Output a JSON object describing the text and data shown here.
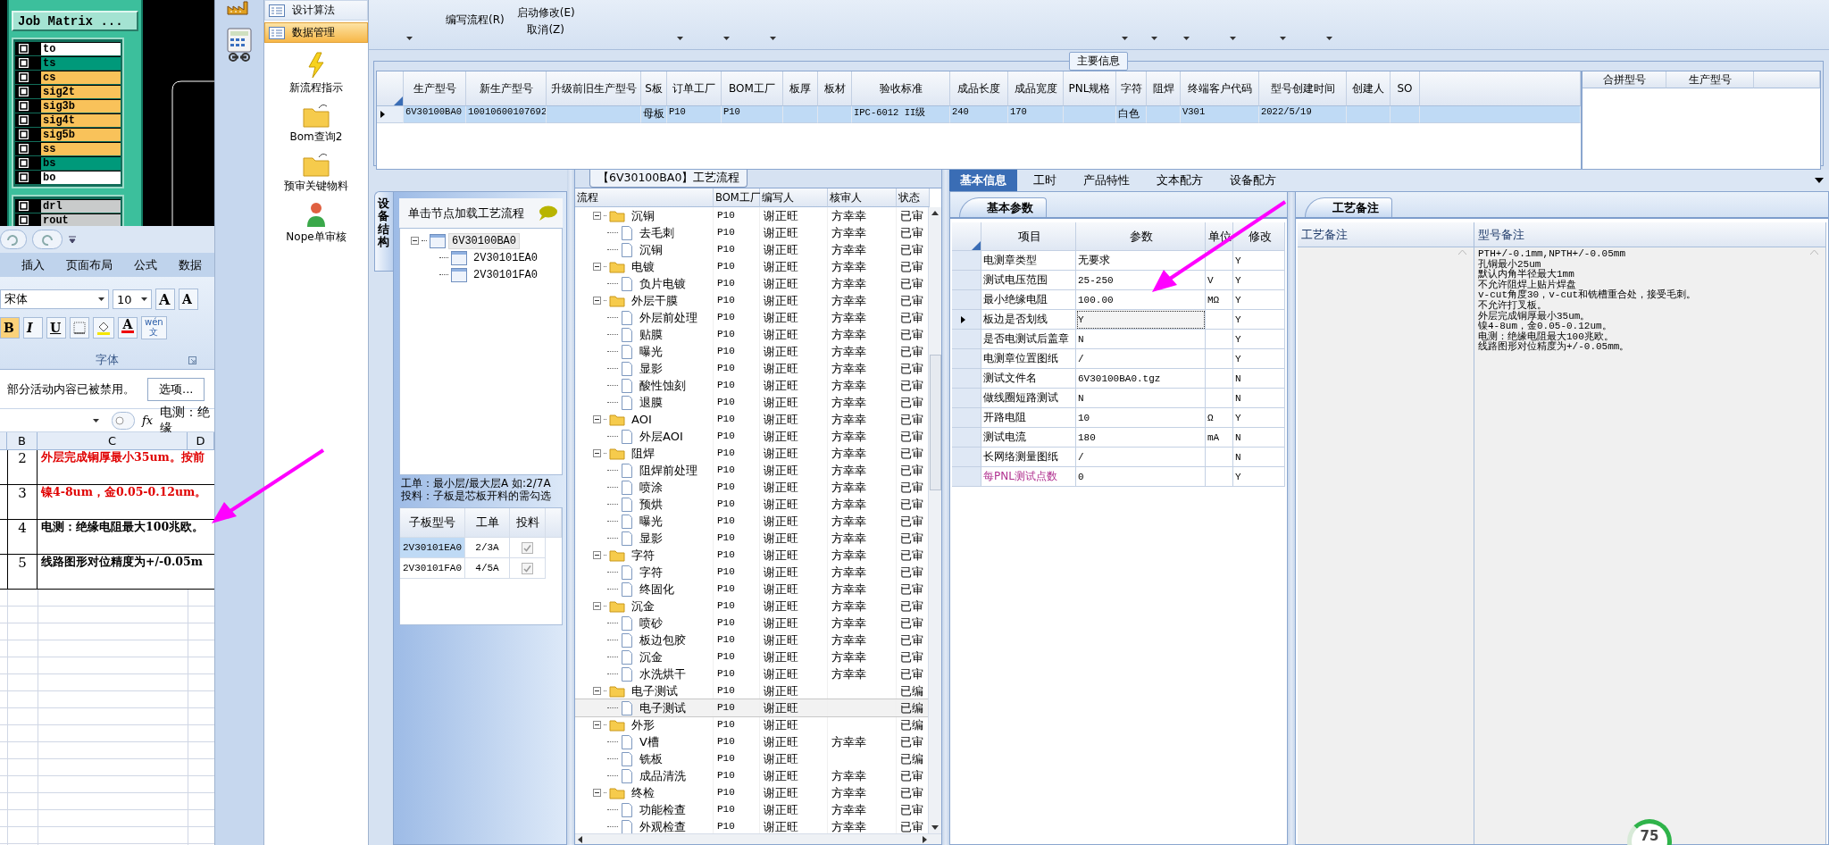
{
  "cad_window": {
    "button": "Job Matrix ...",
    "layer_groups": [
      {
        "layers": [
          {
            "name": "to",
            "color": "#ffffff",
            "checked": false
          },
          {
            "name": "ts",
            "color": "#00997a",
            "checked": false
          },
          {
            "name": "cs",
            "color": "#f9c25a",
            "checked": false
          },
          {
            "name": "sig2t",
            "color": "#f9c25a",
            "checked": false
          },
          {
            "name": "sig3b",
            "color": "#f9c25a",
            "checked": false
          },
          {
            "name": "sig4t",
            "color": "#f9c25a",
            "checked": false
          },
          {
            "name": "sig5b",
            "color": "#f9c25a",
            "checked": false
          },
          {
            "name": "ss",
            "color": "#f9c25a",
            "checked": false
          },
          {
            "name": "bs",
            "color": "#00997a",
            "checked": false
          },
          {
            "name": "bo",
            "color": "#ffffff",
            "checked": false
          }
        ]
      },
      {
        "layers": [
          {
            "name": "drl",
            "color": "#c9cbcb",
            "checked": false
          },
          {
            "name": "rout",
            "color": "#c9cbcb",
            "checked": false
          }
        ]
      }
    ]
  },
  "spreadsheet": {
    "tabs": [
      "插入",
      "页面布局",
      "公式",
      "数据"
    ],
    "font_name": "宋体",
    "font_size": "10",
    "size_buttons": [
      "A",
      "A"
    ],
    "style_buttons": [
      "B",
      "I",
      "U"
    ],
    "color_button": "A",
    "phonetic_button": [
      "wén",
      "文"
    ],
    "group_label": "字体",
    "security_message": "部分活动内容已被禁用。",
    "options_button": "选项...",
    "fx": "fx",
    "formula": "电测：绝缘",
    "columns": [
      "B",
      "C",
      "D"
    ],
    "rows": [
      {
        "number": "2",
        "text": "外层完成铜厚最小35um。按前",
        "color": "#e00000"
      },
      {
        "number": "3",
        "text": "镍4-8um，金0.05-0.12um。",
        "color": "#e00000"
      },
      {
        "number": "4",
        "text": "电测：绝缘电阻最大100兆欧。",
        "color": "#000000"
      },
      {
        "number": "5",
        "text": "线路图形对位精度为+/-0.05m",
        "color": "#000000"
      }
    ]
  },
  "sidebar": {
    "sections": [
      {
        "label": "设计算法",
        "selected": false
      },
      {
        "label": "数据管理",
        "selected": true
      }
    ],
    "items": [
      {
        "label": "新流程指示",
        "kind": "lightning"
      },
      {
        "label": "Bom查询2",
        "kind": "folder"
      },
      {
        "label": "预审关键物料",
        "kind": "folder"
      },
      {
        "label": "Nope单审核",
        "kind": "person"
      }
    ]
  },
  "toolbar": {
    "buttons": [
      "编写流程(R)",
      "启动修改(E)",
      "取消(Z)"
    ]
  },
  "main_info": {
    "title": "主要信息",
    "columns": [
      "生产型号",
      "新生产型号",
      "升级前旧生产型号",
      "S板",
      "订单工厂",
      "BOM工厂",
      "板厚",
      "板材",
      "验收标准",
      "成品长度",
      "成品宽度",
      "PNL规格",
      "字符",
      "阻焊",
      "终端客户代码",
      "型号创建时间",
      "创建人",
      "SO"
    ],
    "rows": [
      {
        "selected": true,
        "cells": [
          "6V30100BA0",
          "10010600107692",
          "",
          "母板",
          "P10",
          "P10",
          "",
          "",
          "IPC-6012 II级",
          "240",
          "170",
          "",
          "白色",
          "",
          "V301",
          "2022/5/19",
          "",
          ""
        ]
      }
    ],
    "merge_columns": [
      "合拼型号",
      "生产型号"
    ]
  },
  "structure": {
    "side_tab": "设备结构",
    "hint": "单击节点加载工艺流程",
    "tree": [
      {
        "label": "6V30100BA0",
        "selected": true,
        "expanded": true,
        "children": [
          {
            "label": "2V30101EA0",
            "selected": false
          },
          {
            "label": "2V30101FA0",
            "selected": false
          }
        ]
      }
    ],
    "note": [
      "工单：最小层/最大层A 如:2/7A",
      "投料：子板是芯板开料的需勾选"
    ],
    "columns": [
      "子板型号",
      "工单",
      "投料"
    ],
    "rows": [
      {
        "model": "2V30101EA0",
        "order": "2/3A",
        "feed": true,
        "selected": true
      },
      {
        "model": "2V30101FA0",
        "order": "4/5A",
        "feed": true,
        "selected": false
      }
    ]
  },
  "process": {
    "title": "【6V30100BA0】工艺流程",
    "columns": [
      "流程",
      "BOM工厂",
      "编写人",
      "核审人",
      "状态"
    ],
    "steps": [
      {
        "name": "沉铜",
        "bom": "P10",
        "writer": "谢正旺",
        "reviewer": "方幸幸",
        "status": "已审",
        "selected": false,
        "expanded": true,
        "children": [
          {
            "name": "去毛刺",
            "bom": "P10",
            "writer": "谢正旺",
            "reviewer": "方幸幸",
            "status": "已审",
            "selected": false
          },
          {
            "name": "沉铜",
            "bom": "P10",
            "writer": "谢正旺",
            "reviewer": "方幸幸",
            "status": "已审",
            "selected": false
          }
        ]
      },
      {
        "name": "电镀",
        "bom": "P10",
        "writer": "谢正旺",
        "reviewer": "方幸幸",
        "status": "已审",
        "selected": false,
        "expanded": true,
        "children": [
          {
            "name": "负片电镀",
            "bom": "P10",
            "writer": "谢正旺",
            "reviewer": "方幸幸",
            "status": "已审",
            "selected": false
          }
        ]
      },
      {
        "name": "外层干膜",
        "bom": "P10",
        "writer": "谢正旺",
        "reviewer": "方幸幸",
        "status": "已审",
        "selected": false,
        "expanded": true,
        "children": [
          {
            "name": "外层前处理",
            "bom": "P10",
            "writer": "谢正旺",
            "reviewer": "方幸幸",
            "status": "已审",
            "selected": false
          },
          {
            "name": "贴膜",
            "bom": "P10",
            "writer": "谢正旺",
            "reviewer": "方幸幸",
            "status": "已审",
            "selected": false
          },
          {
            "name": "曝光",
            "bom": "P10",
            "writer": "谢正旺",
            "reviewer": "方幸幸",
            "status": "已审",
            "selected": false
          },
          {
            "name": "显影",
            "bom": "P10",
            "writer": "谢正旺",
            "reviewer": "方幸幸",
            "status": "已审",
            "selected": false
          },
          {
            "name": "酸性蚀刻",
            "bom": "P10",
            "writer": "谢正旺",
            "reviewer": "方幸幸",
            "status": "已审",
            "selected": false
          },
          {
            "name": "退膜",
            "bom": "P10",
            "writer": "谢正旺",
            "reviewer": "方幸幸",
            "status": "已审",
            "selected": false
          }
        ]
      },
      {
        "name": "AOI",
        "bom": "P10",
        "writer": "谢正旺",
        "reviewer": "方幸幸",
        "status": "已审",
        "selected": false,
        "expanded": true,
        "children": [
          {
            "name": "外层AOI",
            "bom": "P10",
            "writer": "谢正旺",
            "reviewer": "方幸幸",
            "status": "已审",
            "selected": false
          }
        ]
      },
      {
        "name": "阻焊",
        "bom": "P10",
        "writer": "谢正旺",
        "reviewer": "方幸幸",
        "status": "已审",
        "selected": false,
        "expanded": true,
        "children": [
          {
            "name": "阻焊前处理",
            "bom": "P10",
            "writer": "谢正旺",
            "reviewer": "方幸幸",
            "status": "已审",
            "selected": false
          },
          {
            "name": "喷涂",
            "bom": "P10",
            "writer": "谢正旺",
            "reviewer": "方幸幸",
            "status": "已审",
            "selected": false
          },
          {
            "name": "预烘",
            "bom": "P10",
            "writer": "谢正旺",
            "reviewer": "方幸幸",
            "status": "已审",
            "selected": false
          },
          {
            "name": "曝光",
            "bom": "P10",
            "writer": "谢正旺",
            "reviewer": "方幸幸",
            "status": "已审",
            "selected": false
          },
          {
            "name": "显影",
            "bom": "P10",
            "writer": "谢正旺",
            "reviewer": "方幸幸",
            "status": "已审",
            "selected": false
          }
        ]
      },
      {
        "name": "字符",
        "bom": "P10",
        "writer": "谢正旺",
        "reviewer": "方幸幸",
        "status": "已审",
        "selected": false,
        "expanded": true,
        "children": [
          {
            "name": "字符",
            "bom": "P10",
            "writer": "谢正旺",
            "reviewer": "方幸幸",
            "status": "已审",
            "selected": false
          },
          {
            "name": "终固化",
            "bom": "P10",
            "writer": "谢正旺",
            "reviewer": "方幸幸",
            "status": "已审",
            "selected": false
          }
        ]
      },
      {
        "name": "沉金",
        "bom": "P10",
        "writer": "谢正旺",
        "reviewer": "方幸幸",
        "status": "已审",
        "selected": false,
        "expanded": true,
        "children": [
          {
            "name": "喷砂",
            "bom": "P10",
            "writer": "谢正旺",
            "reviewer": "方幸幸",
            "status": "已审",
            "selected": false
          },
          {
            "name": "板边包胶",
            "bom": "P10",
            "writer": "谢正旺",
            "reviewer": "方幸幸",
            "status": "已审",
            "selected": false
          },
          {
            "name": "沉金",
            "bom": "P10",
            "writer": "谢正旺",
            "reviewer": "方幸幸",
            "status": "已审",
            "selected": false
          },
          {
            "name": "水洗烘干",
            "bom": "P10",
            "writer": "谢正旺",
            "reviewer": "方幸幸",
            "status": "已审",
            "selected": false
          }
        ]
      },
      {
        "name": "电子测试",
        "bom": "P10",
        "writer": "谢正旺",
        "status": "已编",
        "selected": false,
        "expanded": true,
        "children": [
          {
            "name": "电子测试",
            "bom": "P10",
            "writer": "谢正旺",
            "status": "已编",
            "selected": true
          }
        ]
      },
      {
        "name": "外形",
        "bom": "P10",
        "writer": "谢正旺",
        "status": "已编",
        "selected": false,
        "expanded": true,
        "children": [
          {
            "name": "V槽",
            "bom": "P10",
            "writer": "谢正旺",
            "reviewer": "方幸幸",
            "status": "已审",
            "selected": false
          },
          {
            "name": "铣板",
            "bom": "P10",
            "writer": "谢正旺",
            "status": "已编",
            "selected": false
          },
          {
            "name": "成品清洗",
            "bom": "P10",
            "writer": "谢正旺",
            "reviewer": "方幸幸",
            "status": "已审",
            "selected": false
          }
        ]
      },
      {
        "name": "终检",
        "bom": "P10",
        "writer": "谢正旺",
        "reviewer": "方幸幸",
        "status": "已审",
        "selected": false,
        "expanded": true,
        "children": [
          {
            "name": "功能检查",
            "bom": "P10",
            "writer": "谢正旺",
            "reviewer": "方幸幸",
            "status": "已审",
            "selected": false
          },
          {
            "name": "外观检查",
            "bom": "P10",
            "writer": "谢正旺",
            "reviewer": "方幸幸",
            "status": "已审",
            "selected": false
          }
        ]
      }
    ]
  },
  "detail_tabs": [
    {
      "label": "基本信息",
      "selected": true
    },
    {
      "label": "工时",
      "selected": false
    },
    {
      "label": "产品特性",
      "selected": false
    },
    {
      "label": "文本配方",
      "selected": false
    },
    {
      "label": "设备配方",
      "selected": false
    }
  ],
  "basic_params": {
    "tab": "基本参数",
    "columns": [
      "项目",
      "参数",
      "单位",
      "修改"
    ],
    "rows": [
      {
        "item": "电测章类型",
        "value": "无要求",
        "modify": "Y",
        "selected": false
      },
      {
        "item": "测试电压范围",
        "value": "25-250",
        "unit": "V",
        "modify": "Y",
        "selected": false
      },
      {
        "item": "最小绝缘电阻",
        "value": "100.00",
        "unit": "MΩ",
        "modify": "Y",
        "selected": false
      },
      {
        "item": "板边是否划线",
        "value": "Y",
        "modify": "Y",
        "selected": true
      },
      {
        "item": "是否电测试后盖章",
        "value": "N",
        "modify": "Y",
        "selected": false
      },
      {
        "item": "电测章位置图纸",
        "value": "/",
        "modify": "Y",
        "selected": false
      },
      {
        "item": "测试文件名",
        "value": "6V30100BA0.tgz",
        "modify": "N",
        "selected": false
      },
      {
        "item": "做线圈短路测试",
        "value": "N",
        "modify": "N",
        "selected": false
      },
      {
        "item": "开路电阻",
        "value": "10",
        "unit": "Ω",
        "modify": "Y",
        "selected": false
      },
      {
        "item": "测试电流",
        "value": "180",
        "unit": "mA",
        "modify": "N",
        "selected": false
      },
      {
        "item": "长网络测量图纸",
        "value": "/",
        "modify": "N",
        "selected": false
      },
      {
        "item": "每PNL测试点数",
        "value": "0",
        "modify": "Y",
        "selected": false,
        "color": "#b0308f"
      }
    ]
  },
  "notes": {
    "tab": "工艺备注",
    "columns": [
      "工艺备注",
      "型号备注"
    ],
    "model_note": [
      "PTH+/-0.1mm,NPTH+/-0.05mm",
      "孔铜最小25um",
      "默认内角半径最大1mm",
      "不允许阻焊上贴片焊盘",
      "v-cut角度30，v-cut和铣槽重合处，接受毛刺。",
      "不允许打叉板。",
      "外层完成铜厚最小35um。",
      "镍4-8um，金0.05-0.12um。",
      "电测：绝缘电阻最大100兆欧。",
      "线路图形对位精度为+/-0.05mm。"
    ]
  },
  "usage_badge": "75"
}
